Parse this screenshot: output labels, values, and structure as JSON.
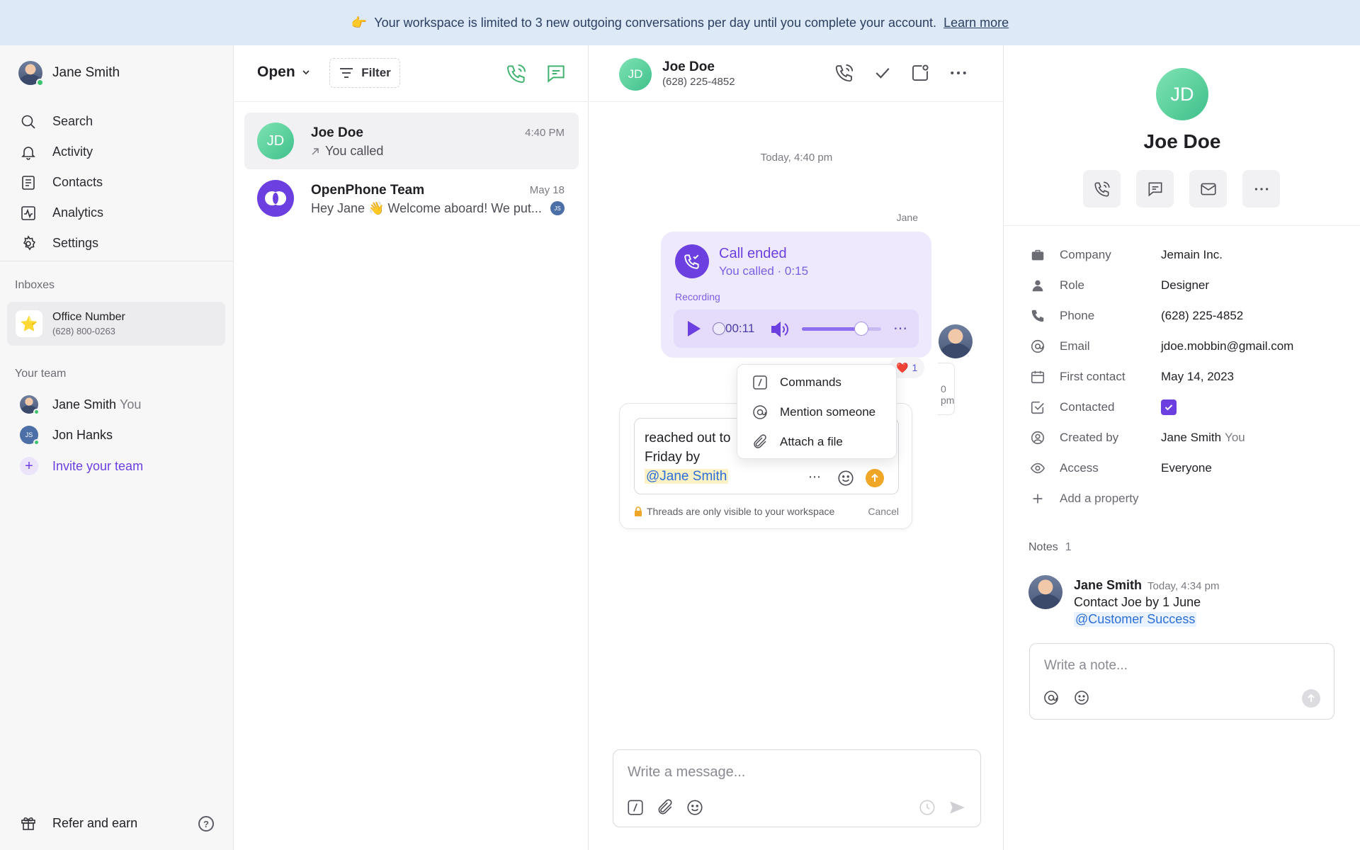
{
  "banner": {
    "emoji": "👉",
    "text": "Your workspace is limited to 3 new outgoing conversations per day until you complete your account.",
    "link": "Learn more"
  },
  "sidebar": {
    "user_name": "Jane Smith",
    "nav": [
      {
        "label": "Search",
        "icon": "search-icon"
      },
      {
        "label": "Activity",
        "icon": "bell-icon"
      },
      {
        "label": "Contacts",
        "icon": "contacts-icon"
      },
      {
        "label": "Analytics",
        "icon": "analytics-icon"
      },
      {
        "label": "Settings",
        "icon": "gear-icon"
      }
    ],
    "inboxes_label": "Inboxes",
    "inbox": {
      "name": "Office Number",
      "phone": "(628) 800-0263",
      "icon": "⭐"
    },
    "team_label": "Your team",
    "team": [
      {
        "name": "Jane Smith",
        "suffix": "You"
      },
      {
        "name": "Jon Hanks",
        "initials": "JS"
      }
    ],
    "invite_label": "Invite your team",
    "refer_label": "Refer and earn",
    "help_glyph": "?"
  },
  "list": {
    "status_label": "Open",
    "filter_label": "Filter",
    "conversations": [
      {
        "initials": "JD",
        "name": "Joe Doe",
        "time": "4:40 PM",
        "preview": "You called"
      },
      {
        "name": "OpenPhone Team",
        "time": "May 18",
        "preview": "Hey Jane 👋 Welcome aboard! We put...",
        "badge": "JS"
      }
    ]
  },
  "chat": {
    "contact_initials": "JD",
    "contact_name": "Joe Doe",
    "contact_phone": "(628) 225-4852",
    "date_separator": "Today, 4:40 pm",
    "sender": "Jane",
    "call": {
      "title": "Call ended",
      "subtitle": "You called · 0:15",
      "recording_label": "Recording",
      "time": "00:11",
      "volume": 0.75
    },
    "reaction": {
      "emoji": "❤️",
      "count": "1"
    },
    "thread_time_fragment": "0 pm",
    "thread": {
      "line1": "reached out to",
      "line2": "Friday by",
      "mention": "@Jane Smith",
      "privacy_note": "Threads are only visible to your workspace",
      "cancel": "Cancel"
    },
    "menu": [
      {
        "label": "Commands",
        "icon": "slash-command-icon"
      },
      {
        "label": "Mention someone",
        "icon": "at-icon"
      },
      {
        "label": "Attach a file",
        "icon": "paperclip-icon"
      }
    ],
    "composer_placeholder": "Write a message..."
  },
  "details": {
    "initials": "JD",
    "name": "Joe Doe",
    "properties": [
      {
        "label": "Company",
        "value": "Jemain Inc.",
        "icon": "briefcase-icon"
      },
      {
        "label": "Role",
        "value": "Designer",
        "icon": "person-icon"
      },
      {
        "label": "Phone",
        "value": "(628) 225-4852",
        "icon": "phone-icon"
      },
      {
        "label": "Email",
        "value": "jdoe.mobbin@gmail.com",
        "icon": "at-icon"
      },
      {
        "label": "First contact",
        "value": "May 14, 2023",
        "icon": "calendar-icon"
      },
      {
        "label": "Contacted",
        "value": "checked",
        "icon": "checkbox-icon"
      },
      {
        "label": "Created by",
        "value": "Jane Smith",
        "suffix": "You",
        "icon": "user-circle-icon"
      },
      {
        "label": "Access",
        "value": "Everyone",
        "icon": "eye-icon"
      }
    ],
    "add_property": "Add a property",
    "notes_label": "Notes",
    "notes_count": "1",
    "note": {
      "author": "Jane Smith",
      "time": "Today, 4:34 pm",
      "text": "Contact Joe by 1 June",
      "mention": "@Customer Success"
    },
    "note_placeholder": "Write a note..."
  },
  "colors": {
    "accent": "#6b3fe0",
    "banner_bg": "#dde9f7",
    "avatar_green": "#3fc08b",
    "send_orange": "#f0a626"
  }
}
